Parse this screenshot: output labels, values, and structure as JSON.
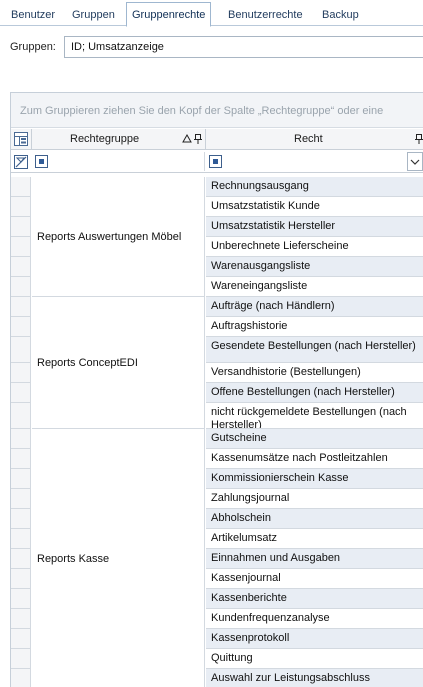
{
  "tabs": [
    {
      "label": "Benutzer",
      "active": false
    },
    {
      "label": "Gruppen",
      "active": false
    },
    {
      "label": "Gruppenrechte",
      "active": true
    },
    {
      "label": "Benutzerrechte",
      "active": false
    },
    {
      "label": "Backup",
      "active": false
    }
  ],
  "group_selector": {
    "label": "Gruppen:",
    "value": "ID; Umsatzanzeige"
  },
  "grid": {
    "group_panel_hint": "Zum Gruppieren ziehen Sie den Kopf der Spalte „Rechtegruppe“ oder eine",
    "columns": {
      "rechtegruppe": "Rechtegruppe",
      "recht": "Recht"
    },
    "groups": [
      {
        "name": "Reports Auswertungen Möbel",
        "rights": [
          "Rechnungsausgang",
          "Umsatzstatistik Kunde",
          "Umsatzstatistik Hersteller",
          "Unberechnete Lieferscheine",
          "Warenausgangsliste",
          "Wareneingangsliste"
        ]
      },
      {
        "name": "Reports ConceptEDI",
        "rights": [
          "Aufträge (nach Händlern)",
          "Auftragshistorie",
          "Gesendete Bestellungen (nach Hersteller)",
          "Versandhistorie (Bestellungen)",
          "Offene Bestellungen (nach Hersteller)",
          "nicht rückgemeldete Bestellungen (nach Hersteller)"
        ]
      },
      {
        "name": "Reports Kasse",
        "rights": [
          "Gutscheine",
          "Kassenumsätze nach Postleitzahlen",
          "Kommissionierschein Kasse",
          "Zahlungsjournal",
          "Abholschein",
          "Artikelumsatz",
          "Einnahmen und Ausgaben",
          "Kassenjournal",
          "Kassenberichte",
          "Kundenfrequenzanalyse",
          "Kassenprotokoll",
          "Quittung",
          "Auswahl zur Leistungsabschluss"
        ]
      }
    ]
  }
}
